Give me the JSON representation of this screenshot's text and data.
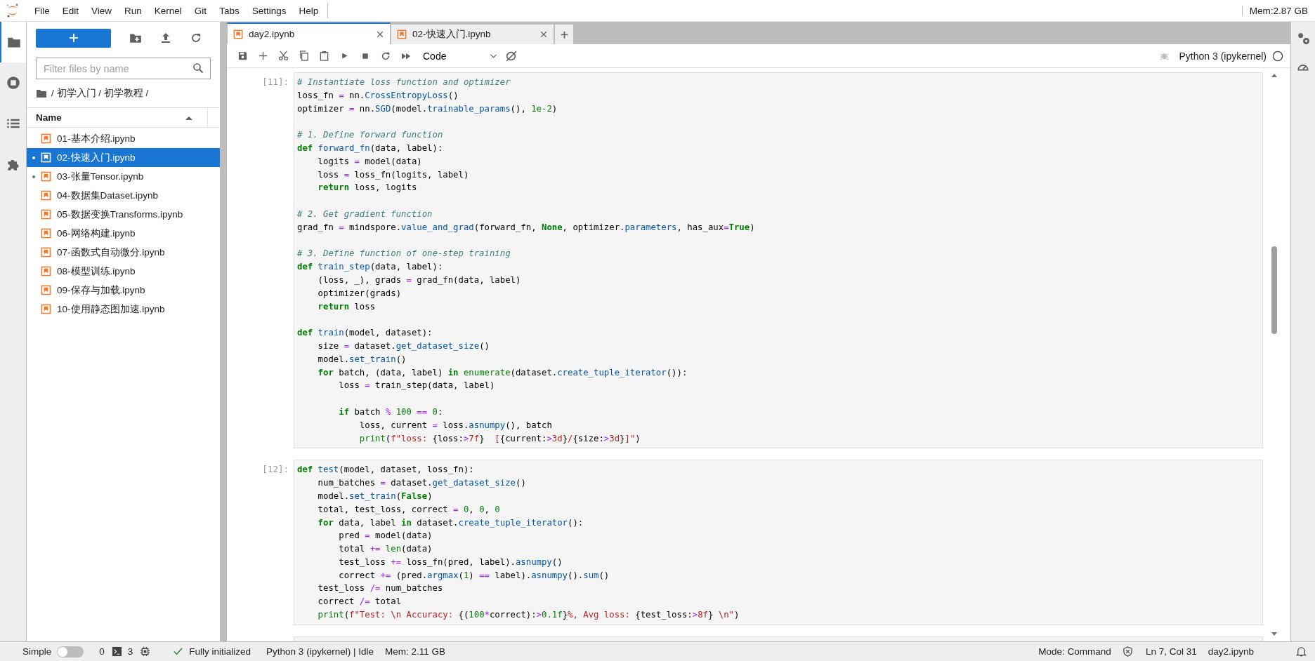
{
  "menu": [
    "File",
    "Edit",
    "View",
    "Run",
    "Kernel",
    "Git",
    "Tabs",
    "Settings",
    "Help"
  ],
  "memory_top": "Mem:2.87 GB",
  "left_bar": [
    {
      "kind": "folder",
      "selected": true
    },
    {
      "kind": "stop",
      "selected": false
    },
    {
      "kind": "list",
      "selected": false
    },
    {
      "kind": "puzzle",
      "selected": false
    }
  ],
  "file_browser": {
    "filter": {
      "placeholder": "Filter files by name"
    },
    "breadcrumb": "/ 初学入门 / 初学教程 /",
    "column": "Name",
    "files": [
      {
        "name": "01-基本介绍.ipynb",
        "selected": false,
        "running": false
      },
      {
        "name": "02-快速入门.ipynb",
        "selected": true,
        "running": true
      },
      {
        "name": "03-张量Tensor.ipynb",
        "selected": false,
        "running": true
      },
      {
        "name": "04-数据集Dataset.ipynb",
        "selected": false,
        "running": false
      },
      {
        "name": "05-数据变换Transforms.ipynb",
        "selected": false,
        "running": false
      },
      {
        "name": "06-网络构建.ipynb",
        "selected": false,
        "running": false
      },
      {
        "name": "07-函数式自动微分.ipynb",
        "selected": false,
        "running": false
      },
      {
        "name": "08-模型训练.ipynb",
        "selected": false,
        "running": false
      },
      {
        "name": "09-保存与加载.ipynb",
        "selected": false,
        "running": false
      },
      {
        "name": "10-使用静态图加速.ipynb",
        "selected": false,
        "running": false
      }
    ]
  },
  "tabs": [
    {
      "label": "day2.ipynb",
      "selected": true
    },
    {
      "label": "02-快速入门.ipynb",
      "selected": false
    }
  ],
  "toolbar": {
    "cell_type": "Code",
    "kernel": "Python 3 (ipykernel)"
  },
  "cells": [
    {
      "prompt": "[11]:",
      "lines": [
        {
          "gap_before": false,
          "tokens": [
            {
              "text": "# Instantiate loss function and optimizer",
              "kind": "comment"
            }
          ]
        },
        {
          "gap_before": false,
          "tokens": [
            {
              "text": "loss_fn ",
              "kind": "plain"
            },
            {
              "text": "=",
              "kind": "operator"
            },
            {
              "text": " nn.",
              "kind": "plain"
            },
            {
              "text": "CrossEntropyLoss",
              "kind": "name"
            },
            {
              "text": "()",
              "kind": "plain"
            }
          ]
        },
        {
          "gap_before": false,
          "tokens": [
            {
              "text": "optimizer ",
              "kind": "plain"
            },
            {
              "text": "=",
              "kind": "operator"
            },
            {
              "text": " nn.",
              "kind": "plain"
            },
            {
              "text": "SGD",
              "kind": "name"
            },
            {
              "text": "(model.",
              "kind": "plain"
            },
            {
              "text": "trainable_params",
              "kind": "name"
            },
            {
              "text": "(), ",
              "kind": "plain"
            },
            {
              "text": "1e-2",
              "kind": "number"
            },
            {
              "text": ")",
              "kind": "plain"
            }
          ]
        },
        {
          "gap_before": true,
          "tokens": [
            {
              "text": "# 1. Define forward function",
              "kind": "comment"
            }
          ]
        },
        {
          "gap_before": false,
          "tokens": [
            {
              "text": "def",
              "kind": "keyword"
            },
            {
              "text": " forward_fn",
              "kind": "name"
            },
            {
              "text": "(data, label):",
              "kind": "plain"
            }
          ]
        },
        {
          "gap_before": false,
          "tokens": [
            {
              "text": "    logits ",
              "kind": "plain"
            },
            {
              "text": "=",
              "kind": "operator"
            },
            {
              "text": " model(data)",
              "kind": "plain"
            }
          ]
        },
        {
          "gap_before": false,
          "tokens": [
            {
              "text": "    loss ",
              "kind": "plain"
            },
            {
              "text": "=",
              "kind": "operator"
            },
            {
              "text": " loss_fn(logits, label)",
              "kind": "plain"
            }
          ]
        },
        {
          "gap_before": false,
          "tokens": [
            {
              "text": "    return",
              "kind": "keyword"
            },
            {
              "text": " loss, logits",
              "kind": "plain"
            }
          ]
        },
        {
          "gap_before": true,
          "tokens": [
            {
              "text": "# 2. Get gradient function",
              "kind": "comment"
            }
          ]
        },
        {
          "gap_before": false,
          "tokens": [
            {
              "text": "grad_fn ",
              "kind": "plain"
            },
            {
              "text": "=",
              "kind": "operator"
            },
            {
              "text": " mindspore.",
              "kind": "plain"
            },
            {
              "text": "value_and_grad",
              "kind": "name"
            },
            {
              "text": "(forward_fn, ",
              "kind": "plain"
            },
            {
              "text": "None",
              "kind": "keyword"
            },
            {
              "text": ", optimizer.",
              "kind": "plain"
            },
            {
              "text": "parameters",
              "kind": "name"
            },
            {
              "text": ", has_aux",
              "kind": "plain"
            },
            {
              "text": "=",
              "kind": "operator"
            },
            {
              "text": "True",
              "kind": "keyword"
            },
            {
              "text": ")",
              "kind": "plain"
            }
          ]
        },
        {
          "gap_before": true,
          "tokens": [
            {
              "text": "# 3. Define function of one-step training",
              "kind": "comment"
            }
          ]
        },
        {
          "gap_before": false,
          "tokens": [
            {
              "text": "def",
              "kind": "keyword"
            },
            {
              "text": " train_step",
              "kind": "name"
            },
            {
              "text": "(data, label):",
              "kind": "plain"
            }
          ]
        },
        {
          "gap_before": false,
          "tokens": [
            {
              "text": "    (loss, _), grads ",
              "kind": "plain"
            },
            {
              "text": "=",
              "kind": "operator"
            },
            {
              "text": " grad_fn(data, label)",
              "kind": "plain"
            }
          ]
        },
        {
          "gap_before": false,
          "tokens": [
            {
              "text": "    optimizer(grads)",
              "kind": "plain"
            }
          ]
        },
        {
          "gap_before": false,
          "tokens": [
            {
              "text": "    return",
              "kind": "keyword"
            },
            {
              "text": " loss",
              "kind": "plain"
            }
          ]
        },
        {
          "gap_before": true,
          "tokens": [
            {
              "text": "def",
              "kind": "keyword"
            },
            {
              "text": " train",
              "kind": "name"
            },
            {
              "text": "(model, dataset):",
              "kind": "plain"
            }
          ]
        },
        {
          "gap_before": false,
          "tokens": [
            {
              "text": "    size ",
              "kind": "plain"
            },
            {
              "text": "=",
              "kind": "operator"
            },
            {
              "text": " dataset.",
              "kind": "plain"
            },
            {
              "text": "get_dataset_size",
              "kind": "name"
            },
            {
              "text": "()",
              "kind": "plain"
            }
          ]
        },
        {
          "gap_before": false,
          "tokens": [
            {
              "text": "    model.",
              "kind": "plain"
            },
            {
              "text": "set_train",
              "kind": "name"
            },
            {
              "text": "()",
              "kind": "plain"
            }
          ]
        },
        {
          "gap_before": false,
          "tokens": [
            {
              "text": "    for",
              "kind": "keyword"
            },
            {
              "text": " batch, (data, label) ",
              "kind": "plain"
            },
            {
              "text": "in",
              "kind": "keyword"
            },
            {
              "text": " enumerate",
              "kind": "builtin"
            },
            {
              "text": "(dataset.",
              "kind": "plain"
            },
            {
              "text": "create_tuple_iterator",
              "kind": "name"
            },
            {
              "text": "()):",
              "kind": "plain"
            }
          ]
        },
        {
          "gap_before": false,
          "tokens": [
            {
              "text": "        loss ",
              "kind": "plain"
            },
            {
              "text": "=",
              "kind": "operator"
            },
            {
              "text": " train_step(data, label)",
              "kind": "plain"
            }
          ]
        },
        {
          "gap_before": true,
          "tokens": [
            {
              "text": "        if",
              "kind": "keyword"
            },
            {
              "text": " batch ",
              "kind": "plain"
            },
            {
              "text": "%",
              "kind": "operator"
            },
            {
              "text": " 100",
              "kind": "number"
            },
            {
              "text": " ==",
              "kind": "operator"
            },
            {
              "text": " 0",
              "kind": "number"
            },
            {
              "text": ":",
              "kind": "plain"
            }
          ]
        },
        {
          "gap_before": false,
          "tokens": [
            {
              "text": "            loss, current ",
              "kind": "plain"
            },
            {
              "text": "=",
              "kind": "operator"
            },
            {
              "text": " loss.",
              "kind": "plain"
            },
            {
              "text": "asnumpy",
              "kind": "name"
            },
            {
              "text": "(), batch",
              "kind": "plain"
            }
          ]
        },
        {
          "gap_before": false,
          "tokens": [
            {
              "text": "            print",
              "kind": "builtin"
            },
            {
              "text": "(",
              "kind": "plain"
            },
            {
              "text": "f\"loss: ",
              "kind": "string"
            },
            {
              "text": "{loss:",
              "kind": "plain"
            },
            {
              "text": ">",
              "kind": "operator"
            },
            {
              "text": "7f",
              "kind": "string"
            },
            {
              "text": "}",
              "kind": "plain"
            },
            {
              "text": "  [",
              "kind": "string"
            },
            {
              "text": "{current:",
              "kind": "plain"
            },
            {
              "text": ">",
              "kind": "operator"
            },
            {
              "text": "3d",
              "kind": "string"
            },
            {
              "text": "}",
              "kind": "plain"
            },
            {
              "text": "/",
              "kind": "string"
            },
            {
              "text": "{size:",
              "kind": "plain"
            },
            {
              "text": ">",
              "kind": "operator"
            },
            {
              "text": "3d",
              "kind": "string"
            },
            {
              "text": "}",
              "kind": "plain"
            },
            {
              "text": "]\"",
              "kind": "string"
            },
            {
              "text": ")",
              "kind": "plain"
            }
          ]
        }
      ]
    },
    {
      "prompt": "[12]:",
      "lines": [
        {
          "gap_before": false,
          "tokens": [
            {
              "text": "def",
              "kind": "keyword"
            },
            {
              "text": " test",
              "kind": "name"
            },
            {
              "text": "(model, dataset, loss_fn):",
              "kind": "plain"
            }
          ]
        },
        {
          "gap_before": false,
          "tokens": [
            {
              "text": "    num_batches ",
              "kind": "plain"
            },
            {
              "text": "=",
              "kind": "operator"
            },
            {
              "text": " dataset.",
              "kind": "plain"
            },
            {
              "text": "get_dataset_size",
              "kind": "name"
            },
            {
              "text": "()",
              "kind": "plain"
            }
          ]
        },
        {
          "gap_before": false,
          "tokens": [
            {
              "text": "    model.",
              "kind": "plain"
            },
            {
              "text": "set_train",
              "kind": "name"
            },
            {
              "text": "(",
              "kind": "plain"
            },
            {
              "text": "False",
              "kind": "keyword"
            },
            {
              "text": ")",
              "kind": "plain"
            }
          ]
        },
        {
          "gap_before": false,
          "tokens": [
            {
              "text": "    total, test_loss, correct ",
              "kind": "plain"
            },
            {
              "text": "=",
              "kind": "operator"
            },
            {
              "text": " 0",
              "kind": "number"
            },
            {
              "text": ", ",
              "kind": "plain"
            },
            {
              "text": "0",
              "kind": "number"
            },
            {
              "text": ", ",
              "kind": "plain"
            },
            {
              "text": "0",
              "kind": "number"
            }
          ]
        },
        {
          "gap_before": false,
          "tokens": [
            {
              "text": "    for",
              "kind": "keyword"
            },
            {
              "text": " data, label ",
              "kind": "plain"
            },
            {
              "text": "in",
              "kind": "keyword"
            },
            {
              "text": " dataset.",
              "kind": "plain"
            },
            {
              "text": "create_tuple_iterator",
              "kind": "name"
            },
            {
              "text": "():",
              "kind": "plain"
            }
          ]
        },
        {
          "gap_before": false,
          "tokens": [
            {
              "text": "        pred ",
              "kind": "plain"
            },
            {
              "text": "=",
              "kind": "operator"
            },
            {
              "text": " model(data)",
              "kind": "plain"
            }
          ]
        },
        {
          "gap_before": false,
          "tokens": [
            {
              "text": "        total ",
              "kind": "plain"
            },
            {
              "text": "+=",
              "kind": "operator"
            },
            {
              "text": " len",
              "kind": "builtin"
            },
            {
              "text": "(data)",
              "kind": "plain"
            }
          ]
        },
        {
          "gap_before": false,
          "tokens": [
            {
              "text": "        test_loss ",
              "kind": "plain"
            },
            {
              "text": "+=",
              "kind": "operator"
            },
            {
              "text": " loss_fn(pred, label).",
              "kind": "plain"
            },
            {
              "text": "asnumpy",
              "kind": "name"
            },
            {
              "text": "()",
              "kind": "plain"
            }
          ]
        },
        {
          "gap_before": false,
          "tokens": [
            {
              "text": "        correct ",
              "kind": "plain"
            },
            {
              "text": "+=",
              "kind": "operator"
            },
            {
              "text": " (pred.",
              "kind": "plain"
            },
            {
              "text": "argmax",
              "kind": "name"
            },
            {
              "text": "(",
              "kind": "plain"
            },
            {
              "text": "1",
              "kind": "number"
            },
            {
              "text": ") ",
              "kind": "plain"
            },
            {
              "text": "==",
              "kind": "operator"
            },
            {
              "text": " label).",
              "kind": "plain"
            },
            {
              "text": "asnumpy",
              "kind": "name"
            },
            {
              "text": "().",
              "kind": "plain"
            },
            {
              "text": "sum",
              "kind": "name"
            },
            {
              "text": "()",
              "kind": "plain"
            }
          ]
        },
        {
          "gap_before": false,
          "tokens": [
            {
              "text": "    test_loss ",
              "kind": "plain"
            },
            {
              "text": "/=",
              "kind": "operator"
            },
            {
              "text": " num_batches",
              "kind": "plain"
            }
          ]
        },
        {
          "gap_before": false,
          "tokens": [
            {
              "text": "    correct ",
              "kind": "plain"
            },
            {
              "text": "/=",
              "kind": "operator"
            },
            {
              "text": " total",
              "kind": "plain"
            }
          ]
        },
        {
          "gap_before": false,
          "tokens": [
            {
              "text": "    print",
              "kind": "builtin"
            },
            {
              "text": "(",
              "kind": "plain"
            },
            {
              "text": "f\"Test: \\n Accuracy: ",
              "kind": "string"
            },
            {
              "text": "{(",
              "kind": "plain"
            },
            {
              "text": "100",
              "kind": "number"
            },
            {
              "text": "*",
              "kind": "operator"
            },
            {
              "text": "correct):",
              "kind": "plain"
            },
            {
              "text": ">",
              "kind": "operator"
            },
            {
              "text": "0.1f",
              "kind": "number"
            },
            {
              "text": "}",
              "kind": "plain"
            },
            {
              "text": "%, Avg loss: ",
              "kind": "string"
            },
            {
              "text": "{test_loss:",
              "kind": "plain"
            },
            {
              "text": ">",
              "kind": "operator"
            },
            {
              "text": "8f",
              "kind": "string"
            },
            {
              "text": "}",
              "kind": "plain"
            },
            {
              "text": " \\n\"",
              "kind": "string"
            },
            {
              "text": ")",
              "kind": "plain"
            }
          ]
        }
      ]
    }
  ],
  "status_bar": {
    "simple_label": "Simple",
    "simple_on": false,
    "terminals": "0",
    "kernels": "3",
    "init": "Fully initialized",
    "kernel": "Python 3 (ipykernel) | Idle",
    "memory": "Mem: 2.11 GB",
    "mode": "Mode: Command",
    "position": "Ln 7, Col 31",
    "file": "day2.ipynb"
  }
}
